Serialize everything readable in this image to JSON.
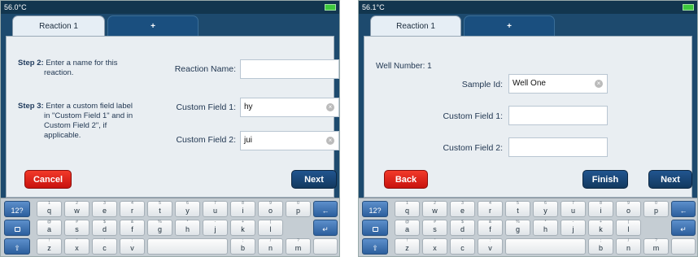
{
  "left": {
    "temperature": "56.0°C",
    "tabs": {
      "active": "Reaction 1",
      "add": "+"
    },
    "step2": {
      "label": "Step 2:",
      "text1": "Enter a name for this",
      "text2": "reaction."
    },
    "step3": {
      "label": "Step 3:",
      "text1": "Enter a custom field label",
      "text2": "in \"Custom Field 1\" and in",
      "text3": "Custom Field 2\", if",
      "text4": "applicable."
    },
    "reaction_name": {
      "label": "Reaction Name:",
      "value": ""
    },
    "custom1": {
      "label": "Custom Field 1:",
      "value": "hy"
    },
    "custom2": {
      "label": "Custom Field 2:",
      "value": "jui"
    },
    "cancel": "Cancel",
    "next": "Next"
  },
  "right": {
    "temperature": "56.1°C",
    "tabs": {
      "active": "Reaction 1",
      "add": "+"
    },
    "well_label": "Well Number:",
    "well_value": "1",
    "sample": {
      "label": "Sample Id:",
      "value": "Well One"
    },
    "custom1": {
      "label": "Custom Field 1:",
      "value": ""
    },
    "custom2": {
      "label": "Custom Field 2:",
      "value": ""
    },
    "back": "Back",
    "finish": "Finish",
    "next": "Next"
  },
  "keyboard": {
    "mode_key": "12?",
    "row1": [
      "q",
      "w",
      "e",
      "r",
      "t",
      "y",
      "u",
      "i",
      "o",
      "p"
    ],
    "row1_hints": [
      "1",
      "2",
      "3",
      "4",
      "5",
      "6",
      "7",
      "8",
      "9",
      "0"
    ],
    "row2": [
      "a",
      "s",
      "d",
      "f",
      "g",
      "h",
      "j",
      "k",
      "l"
    ],
    "row2_hints": [
      "@",
      "#",
      "$",
      "&",
      "%",
      "*",
      "-",
      "+",
      "("
    ],
    "row3": [
      "z",
      "x",
      "c",
      "v",
      "b",
      "n",
      "m"
    ],
    "row3_hints": [
      "!",
      "\"",
      "'",
      ":",
      ";",
      "/",
      "?"
    ]
  },
  "colors": {
    "accent": "#1d4a6e",
    "cancel": "#e0241b",
    "next": "#173f6a",
    "battery": "#3ec93e"
  }
}
